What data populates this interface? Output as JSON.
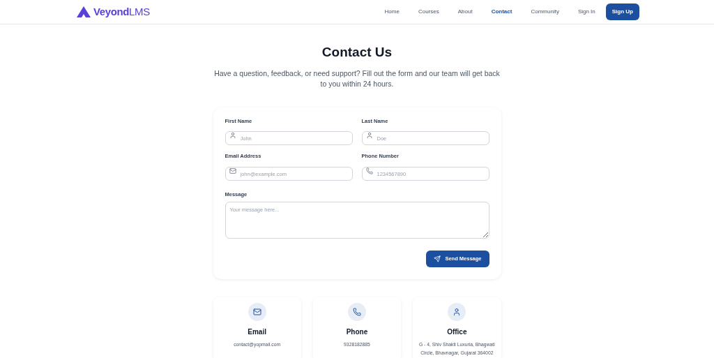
{
  "header": {
    "logo": "**Veyond**LMS",
    "nav": [
      {
        "label": "Home",
        "selected": false
      },
      {
        "label": "Courses",
        "selected": false
      },
      {
        "label": "About",
        "selected": false
      },
      {
        "label": "Contact",
        "selected": true
      },
      {
        "label": "Community",
        "selected": false
      },
      {
        "label": "Sign In",
        "selected": false
      }
    ],
    "signup": "Sign Up"
  },
  "title": "Contact Us",
  "subtitle": "Have a question, feedback, or need support? Fill out the form and our team will get back to you within 24 hours.",
  "form": {
    "fields": [
      {
        "label": "First Name",
        "placeholder": "John",
        "kind": "person"
      },
      {
        "label": "Last Name",
        "placeholder": "Doe",
        "kind": "person"
      },
      {
        "label": "Email Address",
        "placeholder": "john@example.com",
        "kind": "email"
      },
      {
        "label": "Phone Number",
        "placeholder": "1234567890",
        "kind": "phone"
      }
    ],
    "message": {
      "label": "Message",
      "placeholder": "Your message here..."
    },
    "submit": "Send Message"
  },
  "cards": [
    {
      "kind": "email",
      "title": "Email",
      "text": "contact@yopmail.com"
    },
    {
      "kind": "phone",
      "title": "Phone",
      "text": "9328182885"
    },
    {
      "kind": "office",
      "title": "Office",
      "text": "G - 4, Shiv Shakti Luxuria, Bhagwati Circle, Bhavnagar, Gujarat 364002"
    }
  ]
}
